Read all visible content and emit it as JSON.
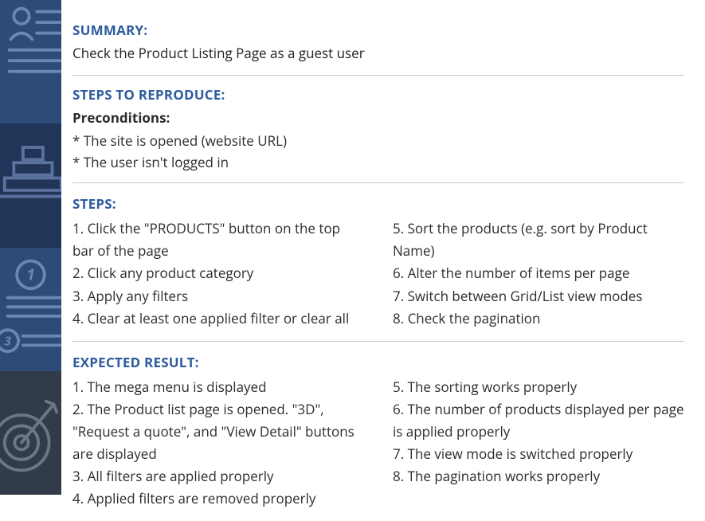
{
  "sections": {
    "summary": {
      "title": "SUMMARY:",
      "text": "Check the Product Listing Page as a guest user"
    },
    "steps_to_reproduce": {
      "title": "STEPS TO REPRODUCE:"
    },
    "preconditions": {
      "label": "Preconditions:",
      "items": [
        "* The site is opened (website URL)",
        "* The user isn't logged in"
      ]
    },
    "steps": {
      "title": "STEPS:",
      "left": [
        "1. Click the \"PRODUCTS\" button on the top bar of the page",
        "2. Click any product category",
        "3. Apply any filters",
        "4. Clear at least one applied filter or clear all"
      ],
      "right": [
        "5. Sort the products (e.g. sort by Product Name)",
        "6. Alter the number of items per page",
        "7. Switch between Grid/List view modes",
        "8. Check the pagination"
      ]
    },
    "expected": {
      "title": "EXPECTED RESULT:",
      "left": [
        "1. The mega menu is displayed",
        "2. The Product list page is opened. \"3D\", \"Request a quote\", and \"View Detail\" buttons are displayed",
        "3. All filters are applied properly",
        "4. Applied filters are removed properly"
      ],
      "right": [
        "5. The sorting works properly",
        "6. The number of products displayed per page is applied properly",
        "7. The view mode is switched properly",
        "8. The pagination works properly"
      ]
    }
  }
}
